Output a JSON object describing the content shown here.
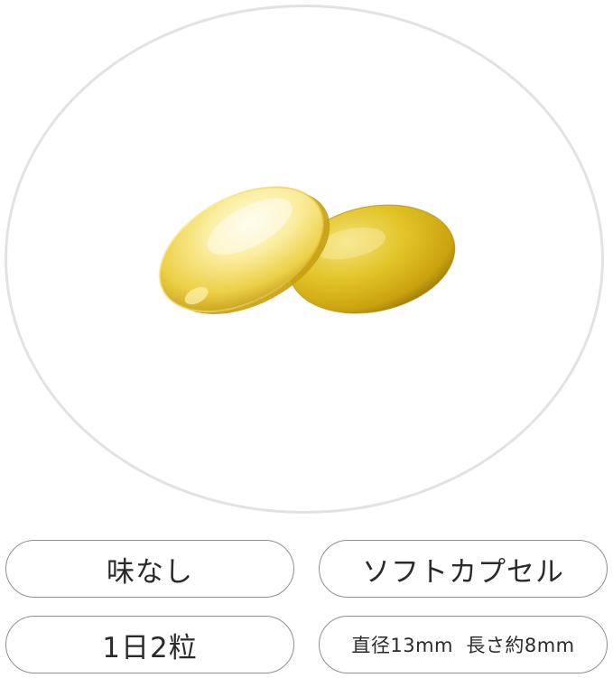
{
  "product_image": {
    "icon": "softgel-capsules-image",
    "colors": {
      "capsule_light": "#fdf3a6",
      "capsule_mid": "#e8c92c",
      "capsule_dark": "#b38f0a",
      "circle_border": "#e2e2e2"
    }
  },
  "features": [
    {
      "label": "味なし"
    },
    {
      "label": "ソフトカプセル"
    },
    {
      "label": "1日2粒"
    },
    {
      "label": "直径13mm  長さ約8mm"
    }
  ]
}
